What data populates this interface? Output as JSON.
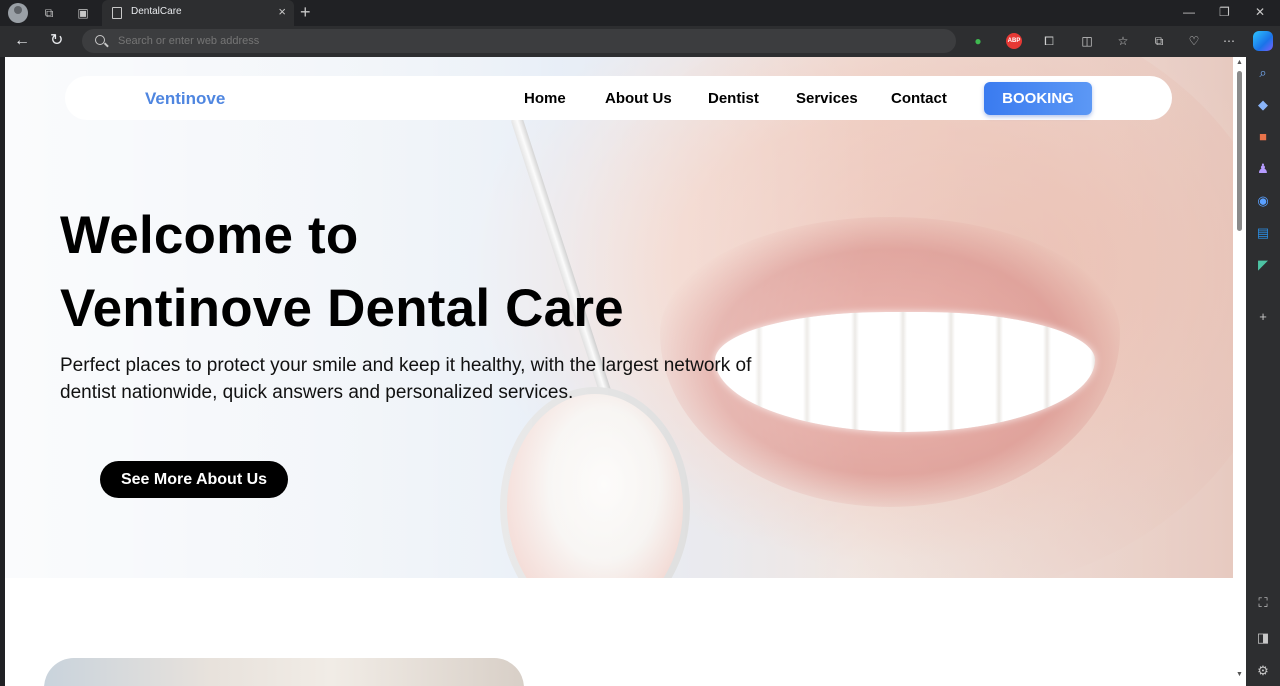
{
  "browser": {
    "tab_title": "DentalCare",
    "new_tab_symbol": "+",
    "tab_close_symbol": "×",
    "address_placeholder": "Search or enter web address",
    "abp_label": "ABP"
  },
  "site": {
    "brand": "Ventinove",
    "nav": {
      "home": "Home",
      "about": "About Us",
      "dentist": "Dentist",
      "services": "Services",
      "contact": "Contact",
      "booking": "BOOKING"
    },
    "hero": {
      "headline_line1": "Welcome to",
      "headline_line2": "Ventinove Dental Care",
      "lead": "Perfect places to protect your smile and keep it healthy, with the largest network of dentist nationwide, quick answers and personalized services.",
      "cta": "See More About Us"
    }
  },
  "colors": {
    "brand": "#4f86e0",
    "booking_button": "#3a7bf0",
    "cta_button": "#000000"
  }
}
